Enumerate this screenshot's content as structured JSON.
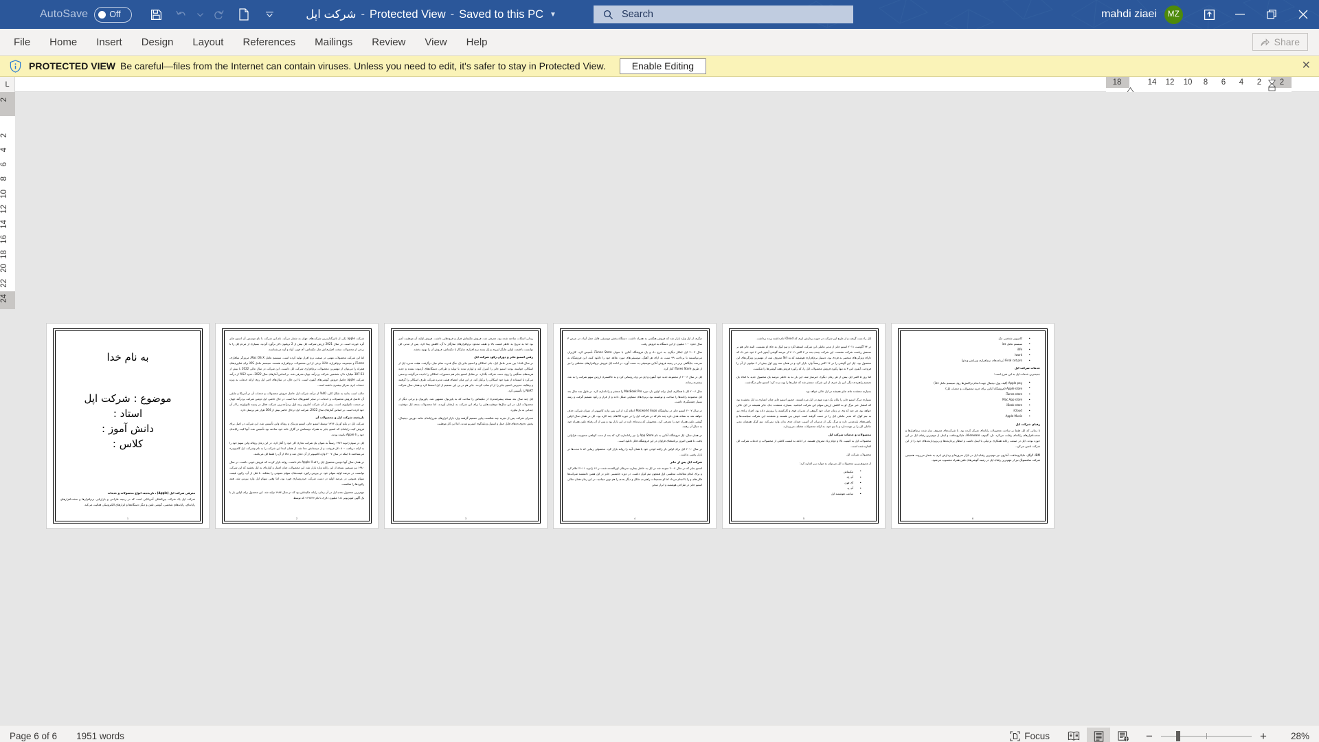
{
  "titlebar": {
    "autosave_label": "AutoSave",
    "autosave_state": "Off",
    "qat": [
      "save-icon",
      "undo-icon",
      "undo-dropdown-icon",
      "redo-icon",
      "new-doc-icon",
      "customize-qat-icon"
    ],
    "doc_name": "شرکت اپل",
    "protected_view": "Protected View",
    "save_state": "Saved to this PC",
    "user_name": "mahdi ziaei",
    "avatar_initials": "MZ",
    "accent_color": "#2b579a",
    "avatar_color": "#4e8a0a"
  },
  "search": {
    "placeholder": "Search",
    "value": ""
  },
  "ribbon": {
    "tabs": [
      "File",
      "Home",
      "Insert",
      "Design",
      "Layout",
      "References",
      "Mailings",
      "Review",
      "View",
      "Help"
    ],
    "share_label": "Share"
  },
  "protected_view_bar": {
    "title": "PROTECTED VIEW",
    "message": "Be careful—files from the Internet can contain viruses. Unless you need to edit, it's safer to stay in Protected View.",
    "button": "Enable Editing",
    "close": "✕",
    "bg_color": "#faf3b8"
  },
  "rulers": {
    "tabstop_marker": "L",
    "horizontal_numbers": [
      "18",
      "14",
      "12",
      "10",
      "8",
      "6",
      "4",
      "2",
      "2"
    ],
    "vertical_numbers": [
      "2",
      "2",
      "4",
      "6",
      "8",
      "10",
      "12",
      "14",
      "16",
      "18",
      "20",
      "22",
      "24"
    ]
  },
  "statusbar": {
    "page_info": "Page 6 of 6",
    "word_count": "1951 words",
    "focus_label": "Focus",
    "views": [
      "read-mode-icon",
      "print-layout-icon",
      "web-layout-icon"
    ],
    "active_view": "print-layout-icon",
    "zoom_out": "−",
    "zoom_in": "+",
    "zoom_level": "28%"
  },
  "document": {
    "pages": [
      {
        "number": "1",
        "type": "title",
        "lines": [
          "به نام خدا",
          "موضوع : شرکت اپل",
          "استاد :",
          "دانش آموز :",
          "کلاس :"
        ],
        "footer_heading": "معرفی شرکت اپل (Apple) ، تاریخچه، انواع محصولات و خدمات",
        "footer_body": "شرکت اپل یک شرکت بین‌المللی آمریکایی است که در زمینه طراحی و بازاریابی نرم‌افزارها و سخت‌افزارهای رایانه‌ای، رایانه‌های شخصی، گوشی تلفن و دیگر دستگاه‌ها و ابزارهای الکترونیکی فعالیت می‌کند."
      },
      {
        "number": "2",
        "type": "body",
        "blocks": [
          {
            "kind": "para",
            "text": "شرکت apple یکی از تاثیرگذارترین شرکت‌های جهان به شمار می‌آید. نام این شرکت با نام موسس آن استیو جابز گره خورده است. در سال 2021 ارزش شرکت اپل بیش از 2 تریلیون دلار برآورد گردید. بسیاری از مردم اپل را با برخی از محصولات سخت افزاری‌اش مثل مکینتاش، آی فون، آیپاد و آیپد می‌شناسند."
          },
          {
            "kind": "para",
            "text": "اما این شرکت محصولات مهمی در صنعت نرم افزار تولید کرده است. سیستم عامل Mac OS X، مرورگر سافاری، iTunes و مجموعه نرم‌افزاری iLife برخی از این محصولات نرم‌افزاری هستند. سیستم عامل iOS برای فناوری‌های همراه را می‌توان از مهمترین محصولات نرم‌افزاری شرکت اپل دانست. این شرکت در سال مالی 2022 با بیش از 387.53 میلیارد دلار، ششمین شرکت پردرآمد جهان معرفی شد. بر اساس آمارهای سال 2022، حدود 52% از درآمد شرکت apple حاصل فروش گوشی‌های آیفون است. با این حال، در سال‌های اخیر اپل روی ارائه خدمات به ویژه خدمات ابری تمرکز بیشتری داشته است."
          },
          {
            "kind": "para",
            "text": "جالب است بدانید به شکل کلی، 40% از درآمد شرکت اپل حاصل فروش محصولات و خدمات آن در آمریکا و مابقی آن حاصل فروش محصولات و خدمات در سایر کشورهای دنیا است. در حال حاضر، اپل دومین شرکت پردرآمد جهان در صنعت تکنولوژی است. پیش از آن شرکت آمازون رتبه اول پردرآمدترین شرکت فعال در زمینه تکنولوژی را از آن خود کرده است. بر اساس آمارهای سال 2022، شرکت اپل درحال حاضر بیش از 164 هزار نفر پرسنل دارد."
          },
          {
            "kind": "head",
            "text": "تاریخچه شرکت اپل و محصولات آن"
          },
          {
            "kind": "para",
            "text": "شرکت اپل در یکم آوریل ۱۹۷۶ توسط استیو جابز، استیو وزنیاک و رونالد واین تأسیس شد. این شرکت در اصل برای فروش کیت رایانه‌ای که استیو جابز به همراه دوستانش در گاراژ خانه خود ساخته بود تأسیس شد. آنها کیت رایانه‌ای خود را Apple I نامیده بودند."
          },
          {
            "kind": "para",
            "text": "اپل در سوم ژانویه ۱۹۷۷ رسماً به عنوان یک شرکت تجاری کار خود را آغاز کرد. در این زمان رونالد واین سهم خود را به ازای دریافت ۸۰۰ دلار فروخت و از دوستانش جدا شد. از همان ابتدا این شرکت را به نام وشرکت اپل کامپیوتر» می‌شناختند تا اینکه در سال ۲۰۰۷ واژه کامپیوتر از آن حذف شد و حالا از آن را فقط اپل می‌نامند."
          },
          {
            "kind": "para",
            "text": "در همان سال آنها دومین محصول اپل را که Apple II نام داشت، روانه بازار کردند که فروش خوبی داشت. در سال ۱۹۸۰ نیز سومین نسخه از این رایانه وارد بازار شد. این محصولات چنان اعتبار و آوازه‌ای به اپل بخشید که این شرکت توانست در عرضه اولیه سهام خود در بورس رکورد قیمت‌های سهام عمومی را بشکند. تا قبل از آن، رکورد قیمت سهام عمومی در عرضه اولیه در دست شرکت خودروسازی فورد بود، اما وقتی سهام اپل وارد بورس شد، همه رکوردها را شکست."
          },
          {
            "kind": "para",
            "text": "مهم‌ترین محصول بعدی اپل در آن زمان، رایانه مکینتاش بود که در سال ۱۹۸۴ تولید شد. این محصول برای اولین بار با یک آگهی تلویزیونی ۱.۵ میلیون دلاری با نام «۱۹۸۴» که توسط"
          }
        ]
      },
      {
        "number": "3",
        "type": "body",
        "blocks": [
          {
            "kind": "para",
            "text": "ریدلی اسکات ساخته شده بود، معرفی شد. فروش مکینتاش فراز و فرودهایی داشت. فروش اولیه آن موفقیت آمیز بود اما به تدریج به خاطر قیمت بالا و طیف محدود نرم‌افزارهای سازگار با آن، کاهش پیدا کرد. پس از مدتی اپل توانست با قیمت اولین چاپگر لیزری و یک بسته نرم افزاری سازگار با مکینتاش، فروش آن را بهبود بخشد."
          },
          {
            "kind": "head",
            "text": "رفتن استیو جابز و دوران رکود شرکت اپل"
          },
          {
            "kind": "para",
            "text": "در سال ۱۹۸۵ بین مدیر عامل اپل، جان اسکالی و استیو جابز یک جنگ قدرت تمام عیار درگرفت. هیئت مدیره اپل از اسکالی خواسته بودند استیو جابز را کنترل کند و لوازم تندند با تولید و طراحی دستگاه‌های آزموده نشده و جدید هزینه‌های سنگینی را روی دست شرکت بگذارد. در مقابل استیو جابز هم دستورات اسکالی را نادیده می‌گرفت و سعی می‌کرد با استفاده از نفوذ خود اسکالی را برکنار کند. در این میان اعضای هیئت مدیره شرکت طرف اسکالی را گرفتند و وظایف مدیریتی استیو جابز را از او سلب کردند. جابز هم در پی این تصمیم از اپل استعفا کرد و همان سال شرکت NeXT را تأسیس کرد."
          },
          {
            "kind": "para",
            "text": "اپل چند سال بعد نسخه پیشرفته‌تری از مکینتاش را ساخت که به پاوربوک مشهور شد. پاوربوک و برخی دیگر از محصولات اپل، در این سال‌ها موفقیت‌هایی را برای این شرکت به ارمغان آوردند. اما محصولات بعدی اپل موفقیت چندانی به بار نیاورد."
          },
          {
            "kind": "para",
            "text": "مدیران شرکت پس از تجربه چند شکست پیاپی تصمیم گرفتند وارد بازار ابزارهای غیررایانه‌ای مانند دوربین دیجیتال، پخش دی‌وی‌دی‌های قابل حمل و استیک و بلندگوی استریو شدند. اما این کار موفقیت"
          }
        ]
      },
      {
        "number": "4",
        "type": "body",
        "blocks": [
          {
            "kind": "para",
            "text": "دیگری از اپل وارد بازار شد که فروش هنگفتی به همراه داشت. دستگاه پخش موسیقی قابل حمل آیپاد. در عرض ۳ سال حدود ۱۰۰ میلیون از این دستگاه به فروش رفت."
          },
          {
            "kind": "para",
            "text": "سال ۲۰۰۳ اپل ابتکار دیگری به خرج داد و یک فروشگاه آنلاین با عنوان iTunes Store تأسیس کرد. کاربران می‌توانستند با پرداخت ۹۹ سنت به ازای هر آهنگ، موسیقی‌های مورد علاقه خود را دانلود کنند. این فروشگاه به سرعت جایگاهی برتر در زمینه فروش آنلاین موسیقی به دست آورد. در ادامه اپل فروش نرم‌افزارهای مختلفی را نیز از طریق iTunes Store آغاز کرد."
          },
          {
            "kind": "para",
            "text": "اپل در سال ۲۰۰۶ از مجموعه جدید خود آیفون و اپل تی وی رونمایی کرد و به خاکستری ارزش سهم شرکت را به عدد بیشتری رساند."
          },
          {
            "kind": "para",
            "text": "سال ۲۰۰۶ اپل با همکاری اینتل برای اولین بار، دوره MacBook Pro را منتشر و راه‌اندازی کرد. در طول چند سال بعد اپل مجموعه رایانه‌ها را ساخت و توانسته بود برتری‌های متفاوتی شکل داده و از فراز و رکود تصمیم گرفت و رشد بسیار چشمگیری داشت."
          },
          {
            "kind": "para",
            "text": "در سال ۲۰۰۷ استیو جابز در نمایشگاه Macworld Expo اعلام کرد از این پس واژه کامپیوتر از عنوان شرکت حذف خواهد شد به نشانه هدف تازه چند نام که در شرکت اپل را در حوزه کالاهای چند کاره بود. اپل در همان سال اولین گوشی تلفن همراه خود را معرفی کرد. محصولی که پدیده‌ای تازه در این بازار بود و پس از آن رقبای تلفن همراه خود به دنبال آن رفتند."
          },
          {
            "kind": "para",
            "text": "در همان سال، اپل فروشگاه آنلاین به نام App Store را نیز راه‌اندازی کرد که بعد از مدت کوتاهی محبوبیت فراوانی یافت. تا همین امروز برنامه‌های فراوان در این فروشگاه قابل دانلود است."
          },
          {
            "kind": "para",
            "text": "در سال ۲۰۱۰ اپل برای اولین بار رایانه لوحی خود یا همان آیپد را روانه بازار کرد. محصولی زیبایی که تا مدت‌ها در بازار رقیبی نداشت."
          },
          {
            "kind": "head",
            "text": "شرکت اپل پس از جابز"
          },
          {
            "kind": "para",
            "text": "استیو جابز که در سال ۲۰۰۴ متوجه شد در اپل به خاطر بیماری سرطان لوزالمعده شده در ۱۷ ژانویه ۲۰۱۱ اعلام کرد و برای انجام معالجات مجلسی اول همچون تیم کوک داشت. در دوره جانشینی جابز در اپل همین دانشمند شرکت‌ها فکر های و را با انجام می‌داد اما او تصمیمات راهبردی شکل و دیگر بعدی را هم نوین مینامید. در این زمان همان سالی استیو جابز در طراحی هوشمند و ابزار سخن"
          }
        ]
      },
      {
        "number": "5",
        "type": "body",
        "blocks": [
          {
            "kind": "para",
            "text": "اپل را دست گرفت و از طرح این شرکت در حوزه پردازش ابری که iCloud نام داشته پرده برداشت."
          },
          {
            "kind": "para",
            "text": "در ۲۴ آگوست ۲۰۱۱ استیو جابز از مدیر عاملی این شرکت استعفا کرد و تیم کوک به جای او نشست. البته جابز هم بر سمتش ریاست شرکت نشست. این شرکت چندی بعد در ۴ اکتبر ۲۰۱۱ از عرضه گوشی آیفون اس ۴ خود خبر داد که دارای ویژگی‌های منحصر به فردی بود. دستیار نرم‌افزاری هوشمند که به Siri معروف شد، از مهمترین ویژگی‌های این محصول بود. اپل این گوشی را در ۱۴ اکتبر رسماً وارد بازار کرد و در همان سه روز اول بیش از ۴ میلیون از آن را فروخت. آیفون اس ۴ نه تنها رکورد فروش محصولات اپل را، که رکورد فروش همه گوشی‌ها را شکست."
          },
          {
            "kind": "para",
            "text": "اما روز ۵ اکتبر اپل بیش از هر زمان دیگری خبرساز شد، این بار نه به خاطر عرضه یک محصول جدید با اتخاذ یک تصمیم راهبردی دیگر. این بار خبری از این شرکت منتشر شد که خیلی‌ها را بهت زده کرد: استیو جابز درگذشت."
          },
          {
            "kind": "para",
            "text": "بسیاری معتقدند جای جابز همیشه در اپل خالی خواهد بود"
          },
          {
            "kind": "para",
            "text": "بسیاری مرگ استیو جابز را پایان یک دوره مهم در اپل می‌دانستند. حضور استیو جابز چنان اعتباری به اپل بخشیده بود که انتشار خبر مرگ او به کاهش ارزش سهام این شرکت انجامید. بسیاری معتقدند جای جابز همیشه در اپل خالی خواهد بود، هر چند که وی در زمان حیات خود گروهی از مدیران قوی و کارکشته را پرورش داده بود. افراد زیادی نیز به تیم کوک که مدیر عاملی اپل را در دست گرفته است خوش بین هستند و معتقدند این شرکت سیاست‌ها و راهبردهای بلندمدتی دارد و مرگ یکی از مدیران آن آسیب چندان جدی بدان وارد نمی‌کند. تیم کوک همچنان مدیر عاملی اپل را بر عهده دارد و با تیم خود، به ارائه محصولات مختلف می‌پردازد."
          },
          {
            "kind": "head",
            "text": "محصولات و خدمات شرکت اپل"
          },
          {
            "kind": "para",
            "text": "محصولات اپل به کیفیت بالا و دوام زیاد معروف هستند. در ادامه به لیست کاملی از محصولات و خدمات شرکت اپل اشاره شده است."
          },
          {
            "kind": "para",
            "text": "محصولات شرکت اپل"
          },
          {
            "kind": "para",
            "text": "از معروف‌ترین محصولات اپل می‌توان به موارد زیر اشاره کرد:"
          },
          {
            "kind": "bullets",
            "items": [
              "مکینتاش",
              "آی پاد",
              "آی فون",
              "آی پد",
              "ساعت هوشمند اپل"
            ]
          }
        ]
      },
      {
        "number": "6",
        "type": "body",
        "blocks": [
          {
            "kind": "bullets",
            "items": [
              "کامپیوتر شخصی مک",
              "سیستم عامل ios",
              "ilife",
              "iwork",
              "Final cut pro (برنامه‌های نرم‌افزاری ویرایش ویدئو)"
            ]
          },
          {
            "kind": "head",
            "text": "خدمات شرکت اپل"
          },
          {
            "kind": "para",
            "text": "جدیدترین خدمات اپل به این شرح است:"
          },
          {
            "kind": "bullets",
            "items": [
              "Apple pay (کیف پول دیجیتال جهت انجام تراکنش‌ها روی سیستم عامل ios)",
              "Apple store (فروشگاه آنلاین برای خرید محصولات و خدمات اپل)",
              "iTunes store",
              "Mac App store",
              "iBook store",
              "iCloud",
              "Apple Music"
            ]
          },
          {
            "kind": "head",
            "text": "رقبای شرکت اپل"
          },
          {
            "kind": "para",
            "text": "تا زمانی که اپل فقط بر ساخت محصولات رایانه‌ای تمرکز کرده بود، با شرکت‌های معروف ساز شده نرم‌افزارها و سخت‌افزارهای رایانه‌ای رقابت می‌کرد. دل، گیتوی، Alienware، مایکروسافت و اینتل از مهم‌ترین رقبای اپل در این حوزه بودند. اپل در صنعت رایانه همکاری نزدیکی با اینتل داشت و انتظار پردازنده‌ها و ریزپردازنده‌های خود را از این شرکت تامین می‌کرد."
          },
          {
            "kind": "para",
            "text": "IBM، گوگل، مایکروسافت، آمازون نیز مهم‌ترین رقبای اپل در بازار سرورها و پردازش ابری به شمار می‌روند. همچنین شرکت سامسونگ نیز از مهم‌ترین رقبای اپل در زمینه گوشی‌های تلفن همراه محسوب می‌شود."
          }
        ]
      }
    ]
  }
}
